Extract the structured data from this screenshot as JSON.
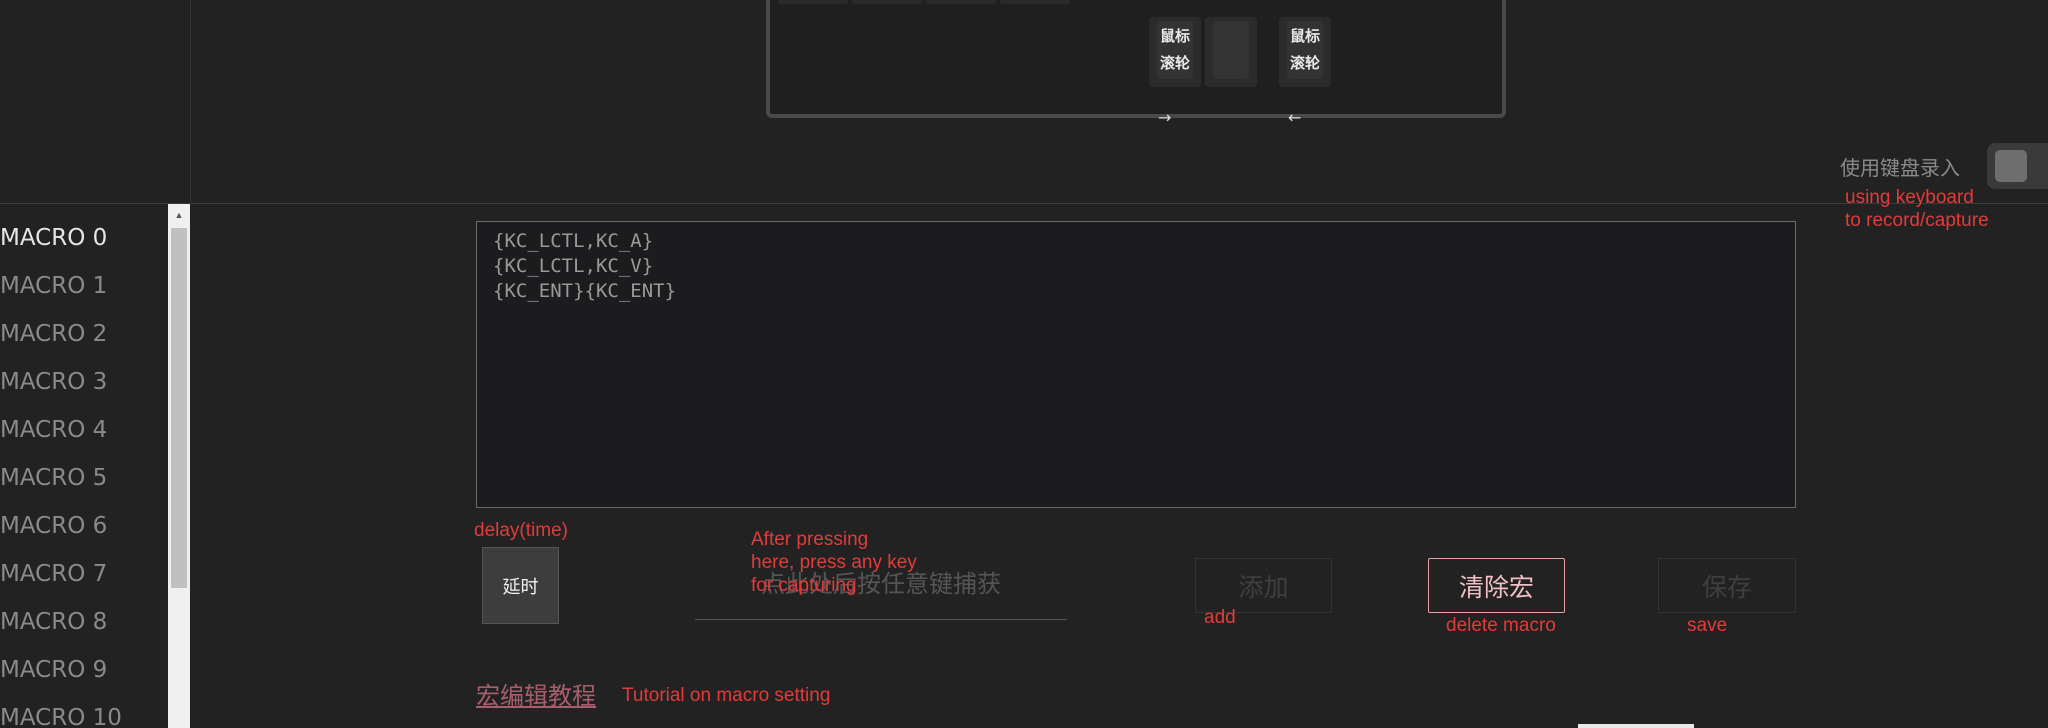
{
  "keyboard_preview": {
    "wheel_left_line1": "鼠标",
    "wheel_left_line2": "滚轮",
    "wheel_left_arrow": "→",
    "wheel_right_line1": "鼠标",
    "wheel_right_line2": "滚轮",
    "wheel_right_arrow": "←"
  },
  "record": {
    "label": "使用键盘录入",
    "toggle_on": false
  },
  "macro_list": {
    "items": [
      "MACRO 0",
      "MACRO 1",
      "MACRO 2",
      "MACRO 3",
      "MACRO 4",
      "MACRO 5",
      "MACRO 6",
      "MACRO 7",
      "MACRO 8",
      "MACRO 9",
      "MACRO 10"
    ],
    "selected_index": 0
  },
  "editor": {
    "lines": [
      "{KC_LCTL,KC_A}",
      "{KC_LCTL,KC_V}",
      "{KC_ENT}{KC_ENT}"
    ]
  },
  "controls": {
    "delay_label": "延时",
    "capture_placeholder": "点此处后按任意键捕获",
    "add_label": "添加",
    "clear_label": "清除宏",
    "save_label": "保存",
    "tutorial_label": "宏编辑教程"
  },
  "annotations": {
    "record_line1": "using keyboard",
    "record_line2": "to record/capture",
    "delay": "delay(time)",
    "capture_line1": "After pressing",
    "capture_line2": "here, press any key",
    "capture_line3": "for capturing",
    "add": "add",
    "delete": "delete macro",
    "save": "save",
    "tutorial": "Tutorial on macro setting"
  },
  "colors": {
    "background": "#222222",
    "annotation": "#e53a3a",
    "clear_button_border": "#e8a0a8",
    "tutorial_link": "#a65f6a"
  }
}
